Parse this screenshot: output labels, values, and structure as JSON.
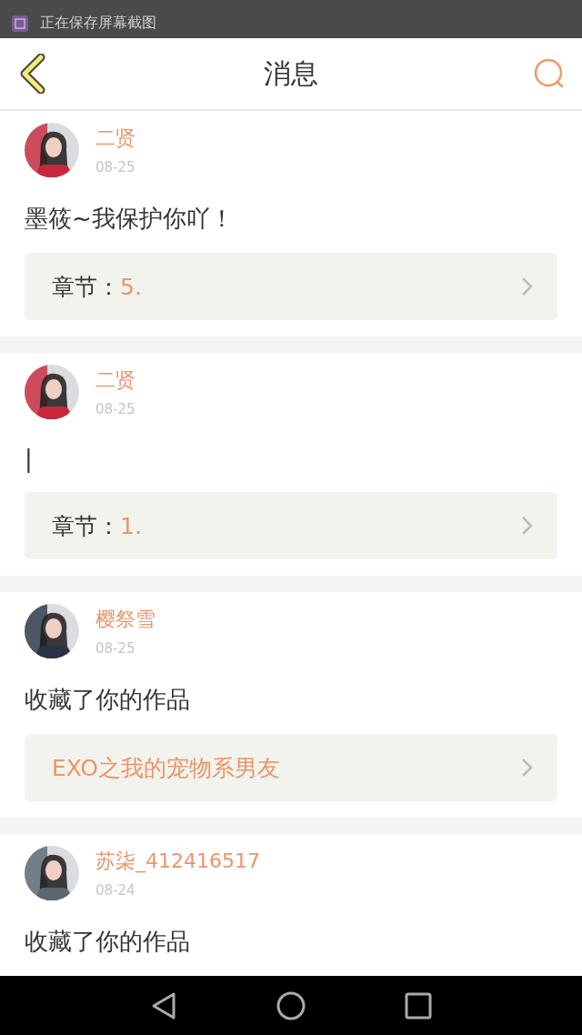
{
  "notification": {
    "text": "正在保存屏幕截图"
  },
  "header": {
    "title": "消息"
  },
  "messages": [
    {
      "user": "二贤",
      "date": "08-25",
      "text": "墨筱~我保护你吖！",
      "link": {
        "kind": "chapter",
        "label": "章节：",
        "value": "5."
      }
    },
    {
      "user": "二贤",
      "date": "08-25",
      "text": "|",
      "link": {
        "kind": "chapter",
        "label": "章节：",
        "value": "1."
      }
    },
    {
      "user": "樱祭雪",
      "date": "08-25",
      "text": "收藏了你的作品",
      "link": {
        "kind": "work",
        "value": "EXO之我的宠物系男友"
      }
    },
    {
      "user": "苏柒_412416517",
      "date": "08-24",
      "text": "收藏了你的作品"
    }
  ]
}
